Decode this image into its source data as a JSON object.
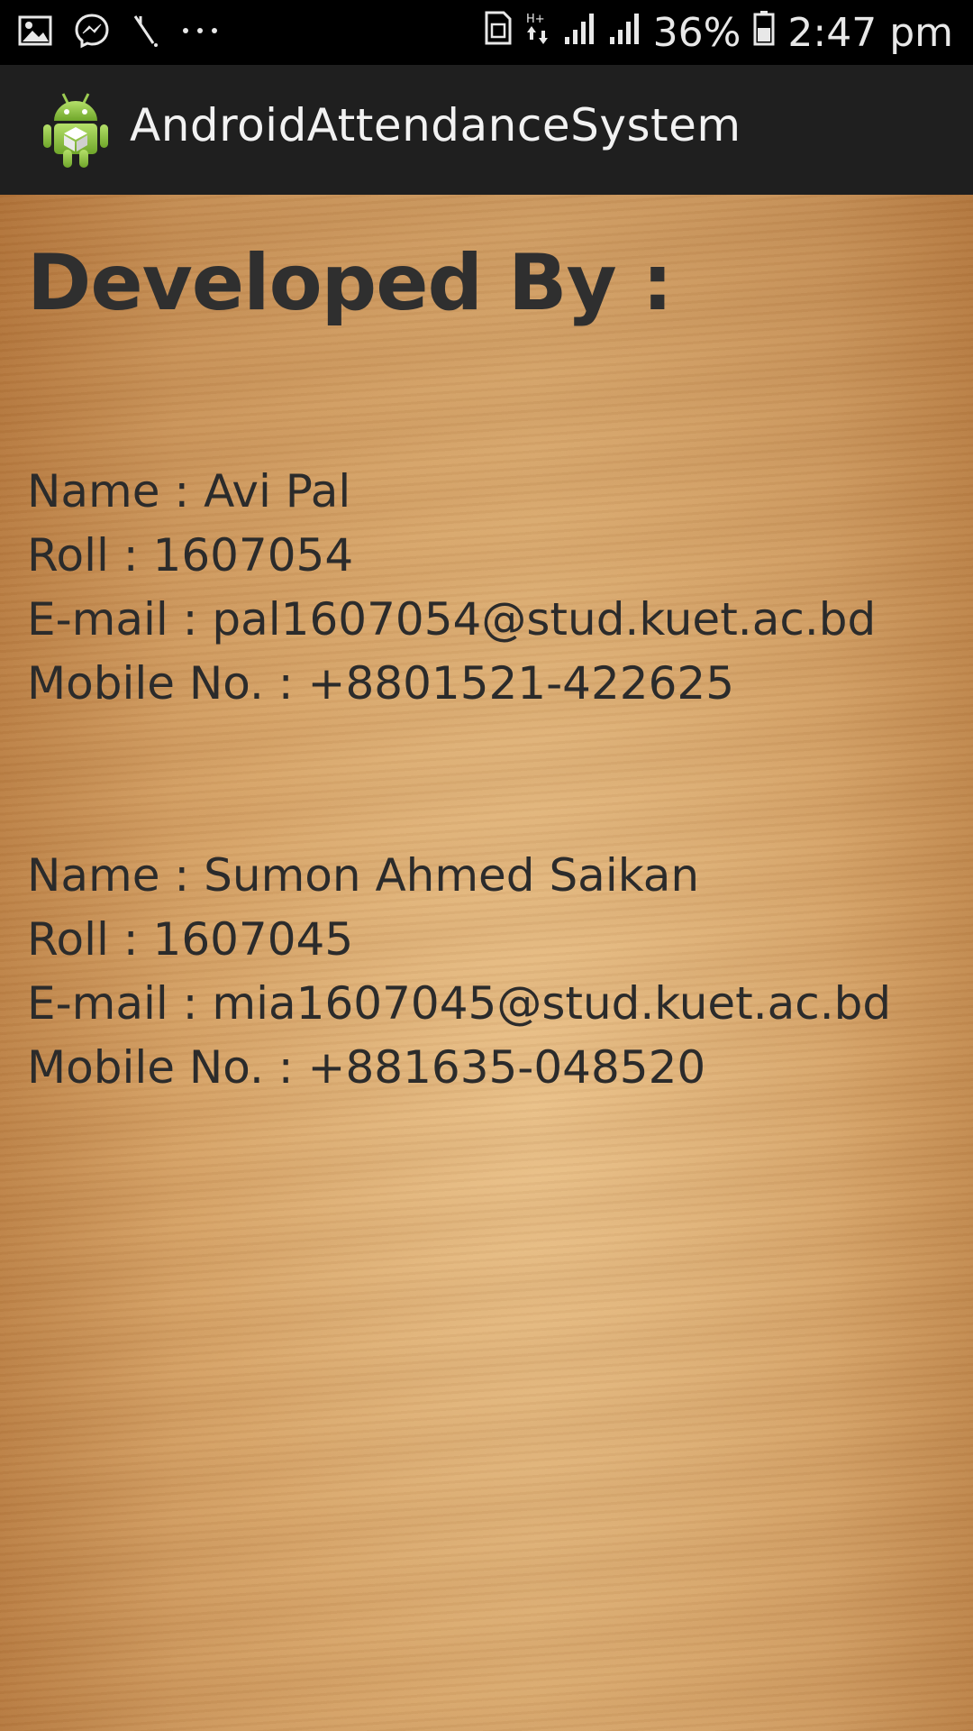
{
  "status_bar": {
    "battery": "36%",
    "time": "2:47 pm",
    "icons": [
      "gallery-icon",
      "messenger-icon",
      "no-signal-icon",
      "more-notifications-icon",
      "sim-icon",
      "data-arrows-icon",
      "signal-icon",
      "signal-icon",
      "battery-icon"
    ]
  },
  "app_bar": {
    "title": "AndroidAttendanceSystem",
    "logo": "android-logo-icon"
  },
  "content": {
    "heading": "Developed By :",
    "developers": [
      {
        "name": "Name : Avi Pal",
        "roll": "Roll : 1607054",
        "email": "E-mail : pal1607054@stud.kuet.ac.bd",
        "mobile": "Mobile No. : +8801521-422625"
      },
      {
        "name": "Name : Sumon Ahmed Saikan",
        "roll": "Roll : 1607045",
        "email": "E-mail : mia1607045@stud.kuet.ac.bd",
        "mobile": "Mobile No. : +881635-048520"
      }
    ]
  },
  "colors": {
    "status_bar_bg": "#000000",
    "app_bar_bg": "#1f1f1f",
    "text": "#2b2b2b",
    "wood_light": "#deb27a",
    "wood_dark": "#b8783c",
    "android_green": "#8bc34a"
  }
}
